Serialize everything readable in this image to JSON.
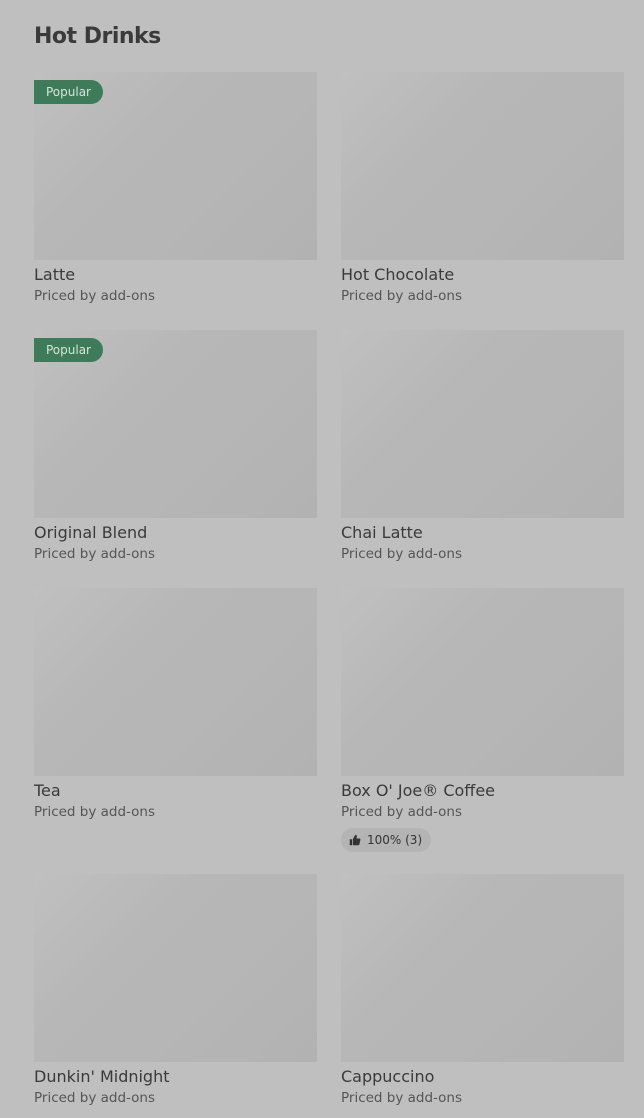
{
  "section": {
    "title": "Hot Drinks"
  },
  "items": [
    {
      "name": "Latte",
      "price": "Priced by add-ons",
      "badge": "Popular"
    },
    {
      "name": "Hot Chocolate",
      "price": "Priced by add-ons"
    },
    {
      "name": "Original Blend",
      "price": "Priced by add-ons",
      "badge": "Popular"
    },
    {
      "name": "Chai Latte",
      "price": "Priced by add-ons"
    },
    {
      "name": "Tea",
      "price": "Priced by add-ons"
    },
    {
      "name": "Box O' Joe® Coffee",
      "price": "Priced by add-ons",
      "rating": "100% (3)",
      "rating_icon": "thumbs-up-icon"
    },
    {
      "name": "Dunkin' Midnight",
      "price": "Priced by add-ons"
    },
    {
      "name": "Cappuccino",
      "price": "Priced by add-ons"
    }
  ],
  "colors": {
    "background": "#bfbfbf",
    "badge": "#3e7b58",
    "image_placeholder": "#b8b8b8"
  }
}
